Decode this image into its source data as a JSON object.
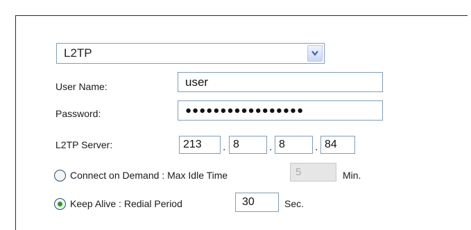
{
  "connection_type": {
    "selected": "L2TP"
  },
  "fields": {
    "username_label": "User Name:",
    "username_value": "user",
    "password_label": "Password:",
    "password_value": "●●●●●●●●●●●●●●●●●",
    "server_label": "L2TP Server:",
    "server_ip": [
      "213",
      "8",
      "8",
      "84"
    ]
  },
  "connect_on_demand": {
    "label": "Connect on Demand : Max Idle Time",
    "value": "5",
    "unit": "Min.",
    "selected": false
  },
  "keep_alive": {
    "label": "Keep Alive : Redial Period",
    "value": "30",
    "unit": "Sec.",
    "selected": true
  },
  "colors": {
    "border": "#7f9db9",
    "radio_selected": "#21a121"
  },
  "icons": {
    "dropdown": "chevron-down-icon"
  }
}
